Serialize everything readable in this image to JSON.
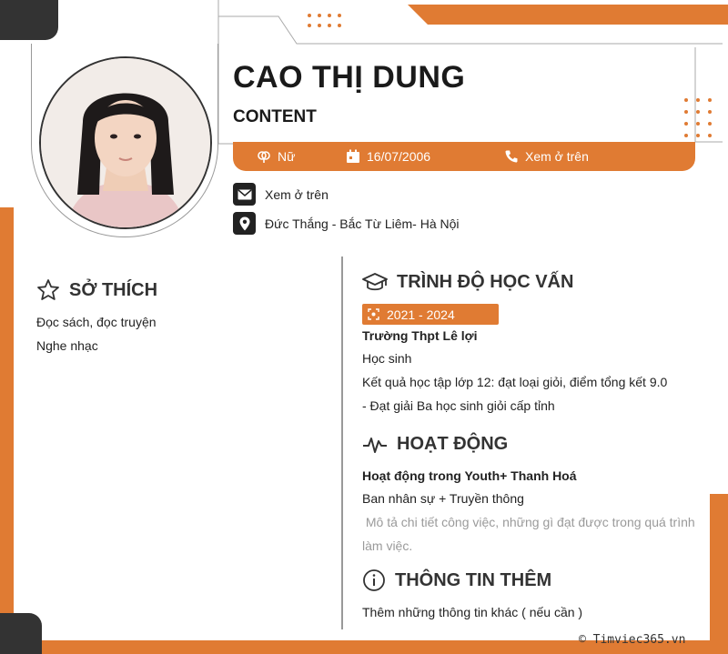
{
  "profile": {
    "name": "CAO THỊ DUNG",
    "position": "CONTENT",
    "gender": "Nữ",
    "birthdate": "16/07/2006",
    "phone": "Xem ở trên",
    "email": "Xem ở trên",
    "address": "Đức Thắng - Bắc Từ Liêm- Hà Nội"
  },
  "hobbies": {
    "title": "SỞ THÍCH",
    "items": [
      "Đọc sách, đọc truyện",
      "Nghe nhạc"
    ]
  },
  "education": {
    "title": "TRÌNH ĐỘ HỌC VẤN",
    "period": "2021 - 2024",
    "school": "Trường Thpt Lê lợi",
    "degree": "Học sinh",
    "lines": [
      "Kết quả học tập lớp 12: đạt loại giỏi, điểm tổng kết 9.0",
      "- Đạt giải Ba học sinh giỏi cấp tỉnh"
    ]
  },
  "activities": {
    "title": "HOẠT ĐỘNG",
    "organization": "Hoạt động trong Youth+ Thanh Hoá",
    "role": "Ban nhân sự + Truyền thông",
    "description_line1": " Mô tả chi tiết công việc, những gì đạt được trong quá trình",
    "description_line2": "làm việc."
  },
  "additional": {
    "title": "THÔNG TIN THÊM",
    "text": "Thêm những thông tin khác ( nếu cần )"
  },
  "footer": {
    "watermark": "© Timviec365.vn"
  },
  "colors": {
    "accent": "#e07b33",
    "dark": "#333333"
  },
  "icons": [
    "gender-icon",
    "calendar-icon",
    "phone-icon",
    "mail-icon",
    "location-icon",
    "star-icon",
    "graduation-cap-icon",
    "pulse-icon",
    "info-icon",
    "target-icon"
  ]
}
